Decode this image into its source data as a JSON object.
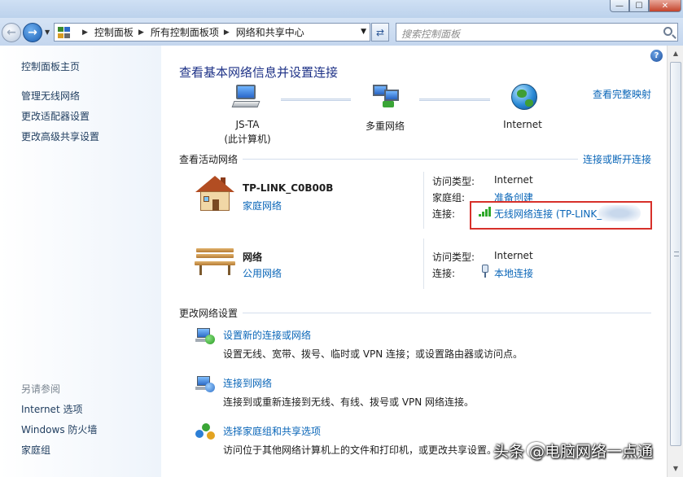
{
  "window": {
    "minimize": "—",
    "maximize": "☐",
    "close": "✕"
  },
  "address": {
    "crumbs": [
      "控制面板",
      "所有控制面板项",
      "网络和共享中心"
    ],
    "search_placeholder": "搜索控制面板"
  },
  "sidebar": {
    "home": "控制面板主页",
    "links": [
      "管理无线网络",
      "更改适配器设置",
      "更改高级共享设置"
    ],
    "see_also_title": "另请参阅",
    "see_also": [
      "Internet 选项",
      "Windows 防火墙",
      "家庭组"
    ]
  },
  "main": {
    "title": "查看基本网络信息并设置连接",
    "view_full_map": "查看完整映射",
    "map": {
      "computer_name": "JS-TA",
      "computer_sub": "(此计算机)",
      "middle": "多重网络",
      "internet": "Internet"
    },
    "active_header": "查看活动网络",
    "connect_disconnect": "连接或断开连接",
    "networks": [
      {
        "name": "TP-LINK_C0B00B",
        "type": "家庭网络",
        "access_label": "访问类型:",
        "access_value": "Internet",
        "homegroup_label": "家庭组:",
        "homegroup_value": "准备创建",
        "conn_label": "连接:",
        "conn_value": "无线网络连接 (TP-LINK_"
      },
      {
        "name": "网络",
        "type": "公用网络",
        "access_label": "访问类型:",
        "access_value": "Internet",
        "conn_label": "连接:",
        "conn_value": "本地连接"
      }
    ],
    "change_header": "更改网络设置",
    "tasks": [
      {
        "title": "设置新的连接或网络",
        "desc": "设置无线、宽带、拨号、临时或 VPN 连接；或设置路由器或访问点。"
      },
      {
        "title": "连接到网络",
        "desc": "连接到或重新连接到无线、有线、拨号或 VPN 网络连接。"
      },
      {
        "title": "选择家庭组和共享选项",
        "desc": "访问位于其他网络计算机上的文件和打印机，或更改共享设置。"
      }
    ]
  },
  "watermark": "头条 @电脑网络一点通",
  "colors": {
    "link": "#0a66b8",
    "title": "#1e3287",
    "highlight_box": "#d7302a"
  }
}
